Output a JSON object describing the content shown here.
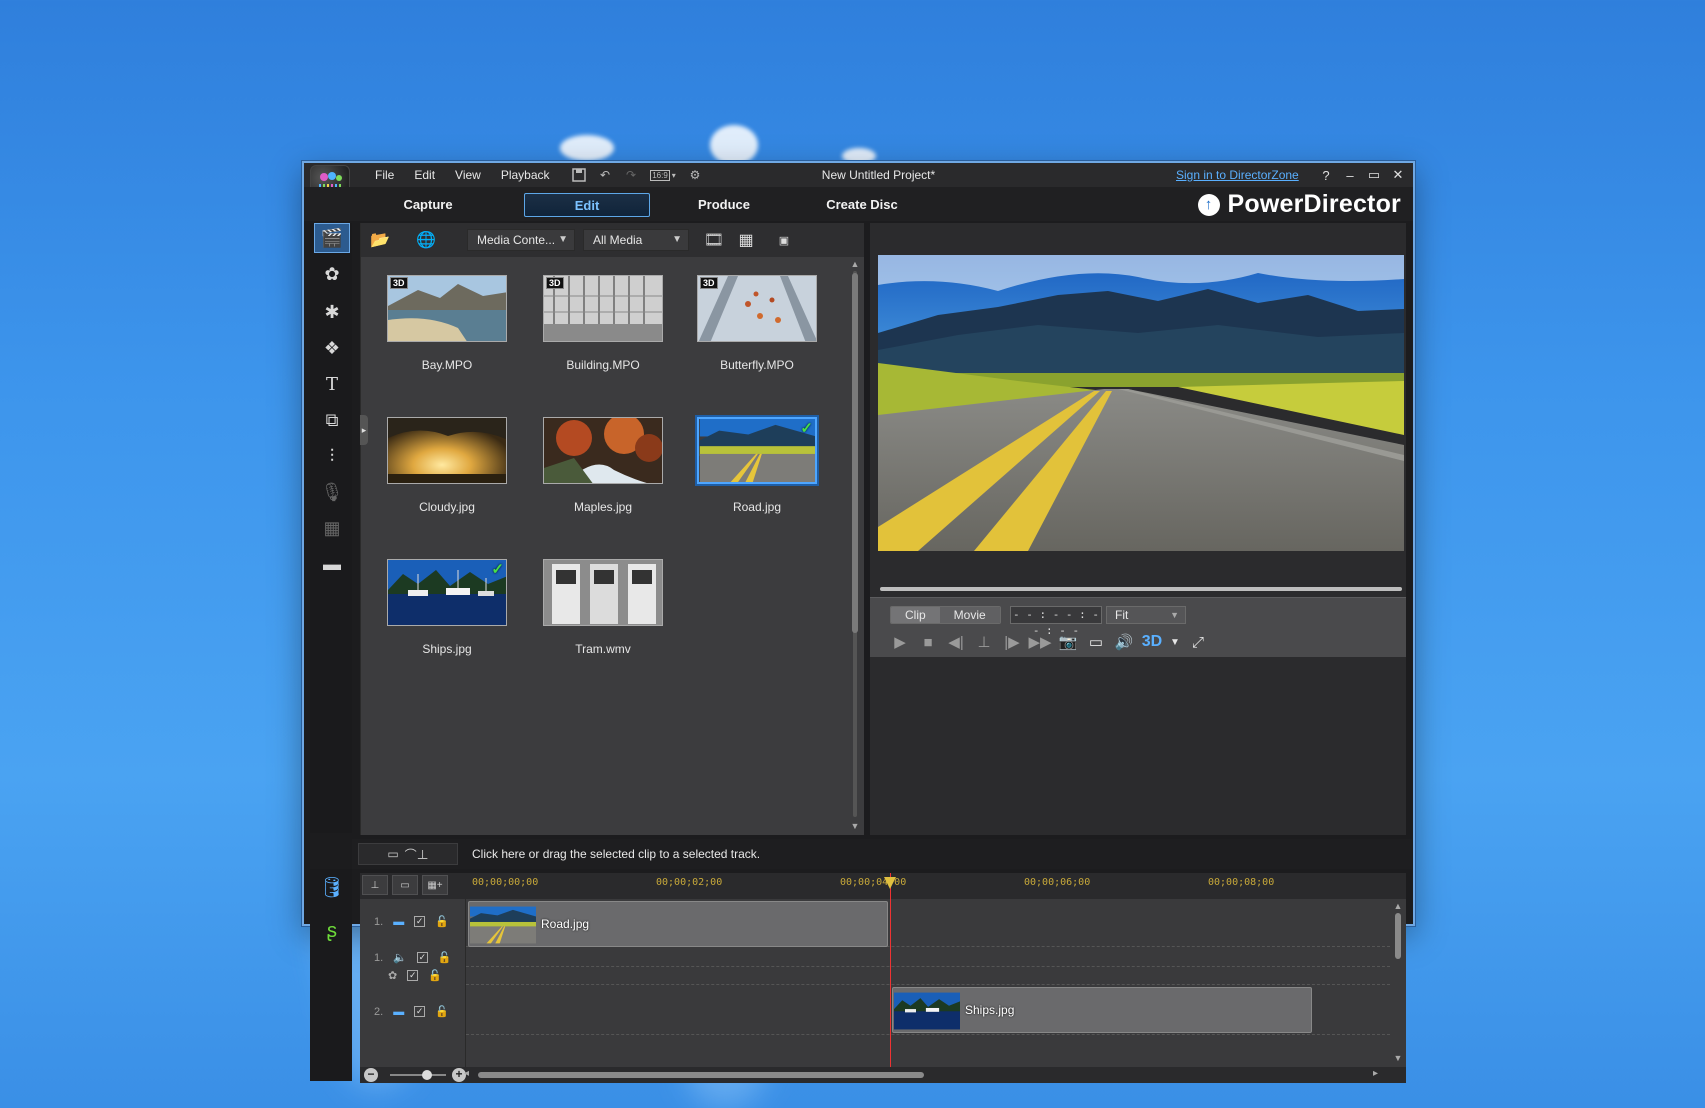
{
  "window": {
    "title": "New Untitled Project*",
    "signin": "Sign in to DirectorZone",
    "menu": [
      "File",
      "Edit",
      "View",
      "Playback"
    ],
    "aspect": "16:9",
    "brand": "PowerDirector"
  },
  "tabs": [
    {
      "label": "Capture",
      "active": false
    },
    {
      "label": "Edit",
      "active": true
    },
    {
      "label": "Produce",
      "active": false
    },
    {
      "label": "Create Disc",
      "active": false
    }
  ],
  "library": {
    "content_dropdown": "Media Conte...",
    "filter_dropdown": "All Media",
    "items": [
      {
        "name": "Bay.MPO",
        "badge": "3D",
        "checked": false,
        "selected": false
      },
      {
        "name": "Building.MPO",
        "badge": "3D",
        "checked": false,
        "selected": false
      },
      {
        "name": "Butterfly.MPO",
        "badge": "3D",
        "checked": false,
        "selected": false
      },
      {
        "name": "Cloudy.jpg",
        "badge": "",
        "checked": false,
        "selected": false
      },
      {
        "name": "Maples.jpg",
        "badge": "",
        "checked": false,
        "selected": false
      },
      {
        "name": "Road.jpg",
        "badge": "",
        "checked": true,
        "selected": true
      },
      {
        "name": "Ships.jpg",
        "badge": "",
        "checked": true,
        "selected": false
      },
      {
        "name": "Tram.wmv",
        "badge": "",
        "checked": false,
        "selected": false
      }
    ]
  },
  "preview": {
    "modes": [
      "Clip",
      "Movie"
    ],
    "timecode": "- - : - - : - - : - -",
    "fit": "Fit",
    "stereo_label": "3D"
  },
  "timeline": {
    "hint": "Click here or drag the selected clip to a selected track.",
    "ticks": [
      "00;00;00;00",
      "00;00;02;00",
      "00;00;04;00",
      "00;00;06;00",
      "00;00;08;00"
    ],
    "tracks": [
      {
        "label": "1.",
        "kind": "video"
      },
      {
        "label": "1.",
        "kind": "audio"
      },
      {
        "label": "",
        "kind": "fx"
      },
      {
        "label": "2.",
        "kind": "video"
      }
    ],
    "clips": [
      {
        "name": "Road.jpg"
      },
      {
        "name": "Ships.jpg"
      }
    ]
  }
}
